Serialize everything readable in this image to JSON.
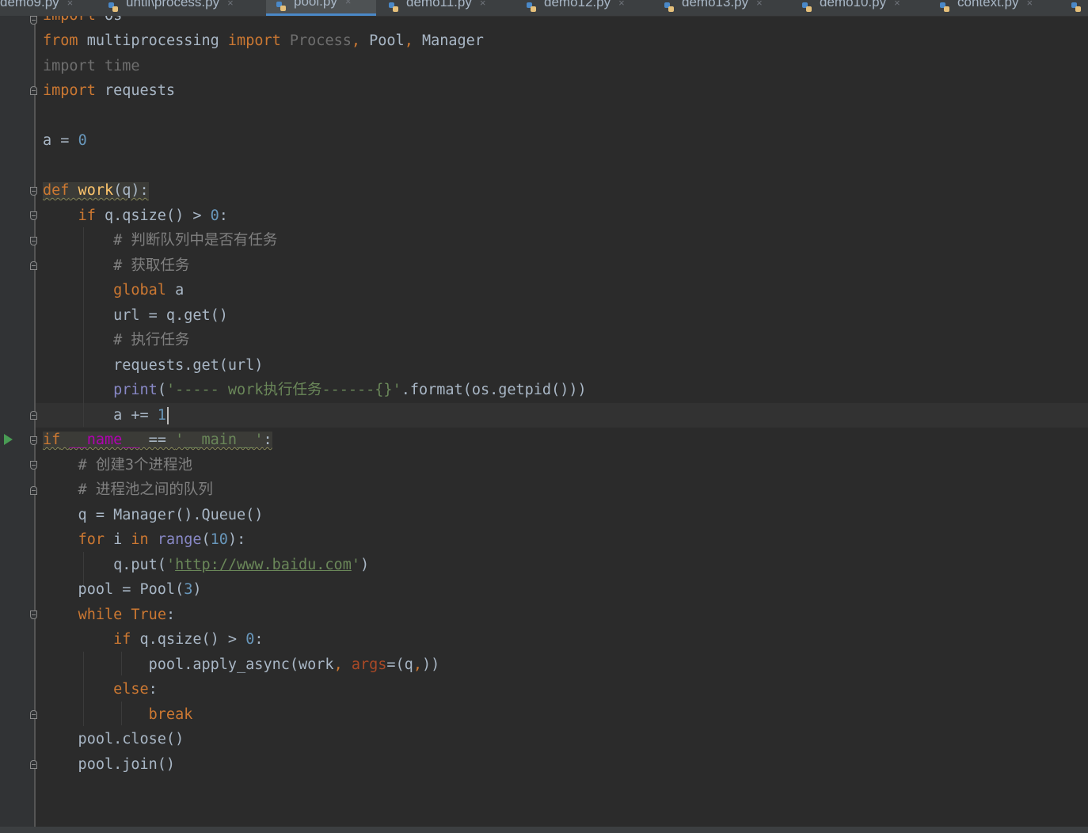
{
  "tabs": [
    {
      "name": "demo9.py",
      "active": false,
      "icon": null
    },
    {
      "name": "until\\process.py",
      "active": false,
      "icon": "python-file-icon"
    },
    {
      "name": "pool.py",
      "active": true,
      "icon": "python-file-icon"
    },
    {
      "name": "demo11.py",
      "active": false,
      "icon": "python-file-icon"
    },
    {
      "name": "demo12.py",
      "active": false,
      "icon": "python-file-icon"
    },
    {
      "name": "demo13.py",
      "active": false,
      "icon": "python-file-icon"
    },
    {
      "name": "demo10.py",
      "active": false,
      "icon": "python-file-icon"
    },
    {
      "name": "context.py",
      "active": false,
      "icon": "python-file-icon"
    }
  ],
  "tab_close_glyph": "×",
  "colors": {
    "background": "#2b2b2b",
    "keyword": "#cc7832",
    "number": "#6897bb",
    "string": "#6a8759",
    "comment": "#808080",
    "builtin": "#8888c6",
    "dunder": "#b200b2",
    "param": "#aa4926",
    "active_tab_accent": "#4a88c7",
    "run_arrow": "#499c54"
  },
  "code": {
    "l0": {
      "a": "import",
      "b": " os"
    },
    "l1": {
      "a": "from",
      "b": " multiprocessing ",
      "c": "import",
      "d": " Process",
      "e": ",",
      "f": " Pool",
      "g": ",",
      "h": " Manager"
    },
    "l2": {
      "a": "import",
      "b": " time"
    },
    "l3": {
      "a": "import",
      "b": " requests"
    },
    "l5": {
      "a": "a = ",
      "b": "0"
    },
    "l7": {
      "a": "def",
      "b": " work",
      "c": "(q):"
    },
    "l8": {
      "a": "    ",
      "b": "if",
      "c": " q.qsize() > ",
      "d": "0",
      "e": ":"
    },
    "l9": "        # 判断队列中是否有任务",
    "l10": "        # 获取任务",
    "l11": {
      "a": "        ",
      "b": "global",
      "c": " a"
    },
    "l12": "        url = q.get()",
    "l13": "        # 执行任务",
    "l14": "        requests.get(url)",
    "l15": {
      "a": "        ",
      "b": "print",
      "c": "(",
      "d": "'----- work执行任务------{}'",
      "e": ".format(os.getpid()))"
    },
    "l16": {
      "a": "        a += ",
      "b": "1"
    },
    "l17": {
      "a": "if",
      "b": " ",
      "c": "__name__",
      "d": " == ",
      "e": "'__main__'",
      "f": ":"
    },
    "l18": "    # 创建3个进程池",
    "l19": "    # 进程池之间的队列",
    "l20": "    q = Manager().Queue()",
    "l21": {
      "a": "    ",
      "b": "for",
      "c": " i ",
      "d": "in",
      "e": " ",
      "f": "range",
      "g": "(",
      "h": "10",
      "i": "):"
    },
    "l22": {
      "a": "        q.put(",
      "b": "'",
      "c": "http://www.baidu.com",
      "d": "'",
      "e": ")"
    },
    "l23": {
      "a": "    pool = Pool(",
      "b": "3",
      "c": ")"
    },
    "l24": {
      "a": "    ",
      "b": "while",
      "c": " ",
      "d": "True",
      "e": ":"
    },
    "l25": {
      "a": "        ",
      "b": "if",
      "c": " q.qsize() > ",
      "d": "0",
      "e": ":"
    },
    "l26": {
      "a": "            pool.apply_async(work",
      "b": ",",
      "c": " ",
      "d": "args",
      "e": "=(q",
      "f": ",",
      "g": "))"
    },
    "l27": {
      "a": "        ",
      "b": "else",
      "c": ":"
    },
    "l28": {
      "a": "            ",
      "b": "break"
    },
    "l29": "    pool.close()",
    "l30": "    pool.join()"
  }
}
